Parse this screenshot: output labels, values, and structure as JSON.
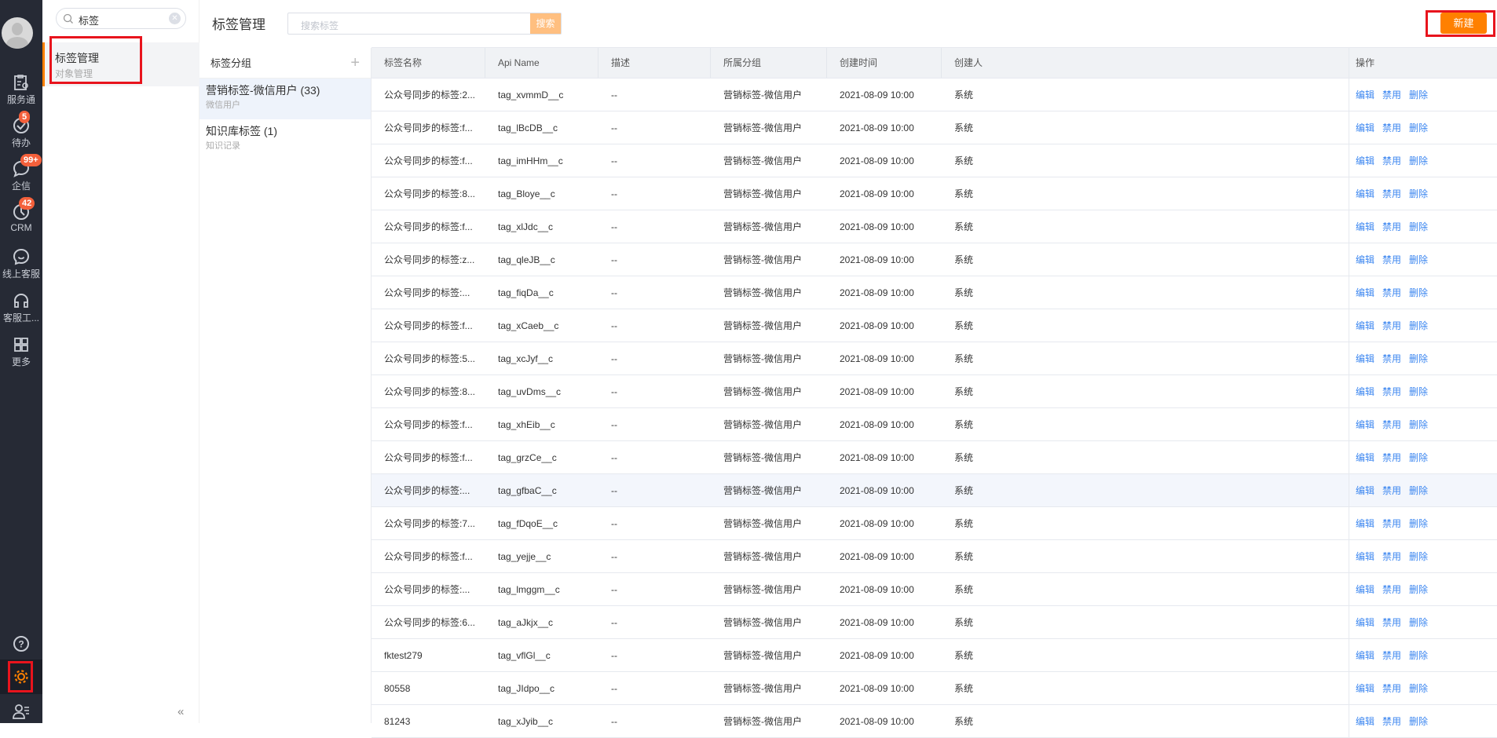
{
  "nav": {
    "items": [
      {
        "label": "服务通",
        "icon": "service-icon"
      },
      {
        "label": "待办",
        "icon": "check-icon",
        "badge": "5"
      },
      {
        "label": "企信",
        "icon": "chat-icon",
        "badge": "99+"
      },
      {
        "label": "CRM",
        "icon": "clock-icon",
        "badge": "42"
      },
      {
        "label": "线上客服",
        "icon": "smile-chat-icon"
      },
      {
        "label": "客服工...",
        "icon": "headset-icon"
      },
      {
        "label": "更多",
        "icon": "grid-icon"
      }
    ]
  },
  "side": {
    "search_value": "标签",
    "active_title": "标签管理",
    "active_sub": "对象管理",
    "collapse": "«"
  },
  "header": {
    "title": "标签管理",
    "search_placeholder": "搜索标签",
    "search_btn": "搜索",
    "new_btn": "新建"
  },
  "groups": {
    "title": "标签分组",
    "add": "+",
    "items": [
      {
        "name": "营销标签-微信用户 (33)",
        "sub": "微信用户"
      },
      {
        "name": "知识库标签 (1)",
        "sub": "知识记录"
      }
    ]
  },
  "table": {
    "columns": [
      "标签名称",
      "Api Name",
      "描述",
      "所属分组",
      "创建时间",
      "创建人",
      "操作"
    ],
    "actions": [
      "编辑",
      "禁用",
      "删除"
    ],
    "rows": [
      [
        "公众号同步的标签:2...",
        "tag_xvmmD__c",
        "--",
        "营销标签-微信用户",
        "2021-08-09 10:00",
        "系统"
      ],
      [
        "公众号同步的标签:f...",
        "tag_lBcDB__c",
        "--",
        "营销标签-微信用户",
        "2021-08-09 10:00",
        "系统"
      ],
      [
        "公众号同步的标签:f...",
        "tag_imHHm__c",
        "--",
        "营销标签-微信用户",
        "2021-08-09 10:00",
        "系统"
      ],
      [
        "公众号同步的标签:8...",
        "tag_Bloye__c",
        "--",
        "营销标签-微信用户",
        "2021-08-09 10:00",
        "系统"
      ],
      [
        "公众号同步的标签:f...",
        "tag_xlJdc__c",
        "--",
        "营销标签-微信用户",
        "2021-08-09 10:00",
        "系统"
      ],
      [
        "公众号同步的标签:z...",
        "tag_qleJB__c",
        "--",
        "营销标签-微信用户",
        "2021-08-09 10:00",
        "系统"
      ],
      [
        "公众号同步的标签:...",
        "tag_fiqDa__c",
        "--",
        "营销标签-微信用户",
        "2021-08-09 10:00",
        "系统"
      ],
      [
        "公众号同步的标签:f...",
        "tag_xCaeb__c",
        "--",
        "营销标签-微信用户",
        "2021-08-09 10:00",
        "系统"
      ],
      [
        "公众号同步的标签:5...",
        "tag_xcJyf__c",
        "--",
        "营销标签-微信用户",
        "2021-08-09 10:00",
        "系统"
      ],
      [
        "公众号同步的标签:8...",
        "tag_uvDms__c",
        "--",
        "营销标签-微信用户",
        "2021-08-09 10:00",
        "系统"
      ],
      [
        "公众号同步的标签:f...",
        "tag_xhEib__c",
        "--",
        "营销标签-微信用户",
        "2021-08-09 10:00",
        "系统"
      ],
      [
        "公众号同步的标签:f...",
        "tag_grzCe__c",
        "--",
        "营销标签-微信用户",
        "2021-08-09 10:00",
        "系统"
      ],
      [
        "公众号同步的标签:...",
        "tag_gfbaC__c",
        "--",
        "营销标签-微信用户",
        "2021-08-09 10:00",
        "系统"
      ],
      [
        "公众号同步的标签:7...",
        "tag_fDqoE__c",
        "--",
        "营销标签-微信用户",
        "2021-08-09 10:00",
        "系统"
      ],
      [
        "公众号同步的标签:f...",
        "tag_yejje__c",
        "--",
        "营销标签-微信用户",
        "2021-08-09 10:00",
        "系统"
      ],
      [
        "公众号同步的标签:...",
        "tag_lmggm__c",
        "--",
        "营销标签-微信用户",
        "2021-08-09 10:00",
        "系统"
      ],
      [
        "公众号同步的标签:6...",
        "tag_aJkjx__c",
        "--",
        "营销标签-微信用户",
        "2021-08-09 10:00",
        "系统"
      ],
      [
        "fktest279",
        "tag_vflGl__c",
        "--",
        "营销标签-微信用户",
        "2021-08-09 10:00",
        "系统"
      ],
      [
        "80558",
        "tag_JIdpo__c",
        "--",
        "营销标签-微信用户",
        "2021-08-09 10:00",
        "系统"
      ],
      [
        "81243",
        "tag_xJyib__c",
        "--",
        "营销标签-微信用户",
        "2021-08-09 10:00",
        "系统"
      ]
    ]
  },
  "colors": {
    "accent": "#ff8000",
    "link": "#3b86f0",
    "nav_bg": "#262a35"
  }
}
